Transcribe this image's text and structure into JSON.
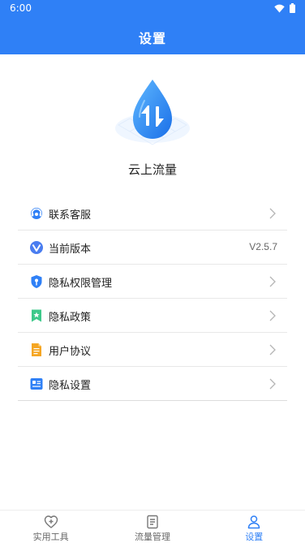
{
  "status": {
    "time": "6:00"
  },
  "header": {
    "title": "设置"
  },
  "app": {
    "name": "云上流量"
  },
  "settings": [
    {
      "label": "联系客服",
      "icon": "customer-service-icon",
      "value": ""
    },
    {
      "label": "当前版本",
      "icon": "version-icon",
      "value": "V2.5.7"
    },
    {
      "label": "隐私权限管理",
      "icon": "shield-key-icon",
      "value": ""
    },
    {
      "label": "隐私政策",
      "icon": "bookmark-star-icon",
      "value": ""
    },
    {
      "label": "用户协议",
      "icon": "document-icon",
      "value": ""
    },
    {
      "label": "隐私设置",
      "icon": "id-card-icon",
      "value": ""
    }
  ],
  "nav": [
    {
      "label": "实用工具",
      "icon": "heart-plus-icon",
      "active": false
    },
    {
      "label": "流量管理",
      "icon": "list-doc-icon",
      "active": false
    },
    {
      "label": "设置",
      "icon": "user-icon",
      "active": true
    }
  ],
  "colors": {
    "primary": "#2f80f6",
    "orange": "#f5a623",
    "green": "#3ec98b"
  }
}
